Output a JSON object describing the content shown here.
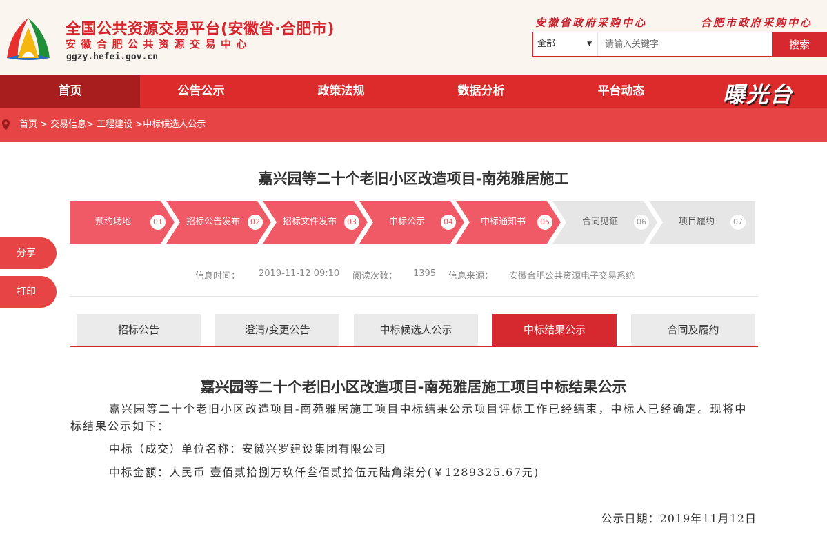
{
  "header": {
    "site_title": "全国公共资源交易平台(安徽省·合肥市)",
    "site_subtitle": "安徽合肥公共资源交易中心",
    "site_domain": "ggzy.hefei.gov.cn",
    "link_province": "安徽省政府采购中心",
    "link_city": "合肥市政府采购中心",
    "search": {
      "scope": "全部",
      "placeholder": "请输入关键字",
      "button_label": "搜索"
    }
  },
  "nav": {
    "items": [
      {
        "label": "首页",
        "active": true
      },
      {
        "label": "公告公示"
      },
      {
        "label": "政策法规"
      },
      {
        "label": "数据分析"
      },
      {
        "label": "平台动态"
      }
    ],
    "brand": "曝光台"
  },
  "breadcrumb": {
    "items": [
      "首页",
      "交易信息",
      "工程建设",
      "中标候选人公示"
    ],
    "text": "首页 > 交易信息> 工程建设 >中标候选人公示"
  },
  "page_title": "嘉兴园等二十个老旧小区改造项目-南苑雅居施工",
  "steps": [
    {
      "label": "预约场地",
      "num": "01",
      "done": true
    },
    {
      "label": "招标公告发布",
      "num": "02",
      "done": true
    },
    {
      "label": "招标文件发布",
      "num": "03",
      "done": true
    },
    {
      "label": "中标公示",
      "num": "04",
      "done": true
    },
    {
      "label": "中标通知书",
      "num": "05",
      "done": true
    },
    {
      "label": "合同见证",
      "num": "06",
      "done": false
    },
    {
      "label": "项目履约",
      "num": "07",
      "done": false
    }
  ],
  "info": {
    "time_label": "信息时间：",
    "time_value": "2019-11-12 09:10",
    "reads_label": "阅读次数：",
    "reads_value": "1395",
    "source_label": "信息来源：",
    "source_value": "安徽合肥公共资源电子交易系统"
  },
  "tabs": [
    {
      "label": "招标公告"
    },
    {
      "label": "澄清/变更公告"
    },
    {
      "label": "中标候选人公示"
    },
    {
      "label": "中标结果公示",
      "active": true
    },
    {
      "label": "合同及履约"
    }
  ],
  "notice": {
    "title": "嘉兴园等二十个老旧小区改造项目-南苑雅居施工项目中标结果公示",
    "intro": "嘉兴园等二十个老旧小区改造项目-南苑雅居施工项目中标结果公示项目评标工作已经结束，中标人已经确定。现将中标结果公示如下：",
    "winner": "中标（成交）单位名称：安徽兴罗建设集团有限公司",
    "amount": "中标金额：人民币 壹佰贰拾捌万玖仟叁佰贰拾伍元陆角柒分(￥1289325.67元)",
    "date": "公示日期：2019年11月12日"
  },
  "float_buttons": {
    "share": "分享",
    "print": "打印"
  },
  "colors": {
    "brand_red": "#d6282f",
    "nav_red": "#dd2b2c",
    "step_pink": "#f05a66",
    "step_gray": "#e6e6e6"
  }
}
